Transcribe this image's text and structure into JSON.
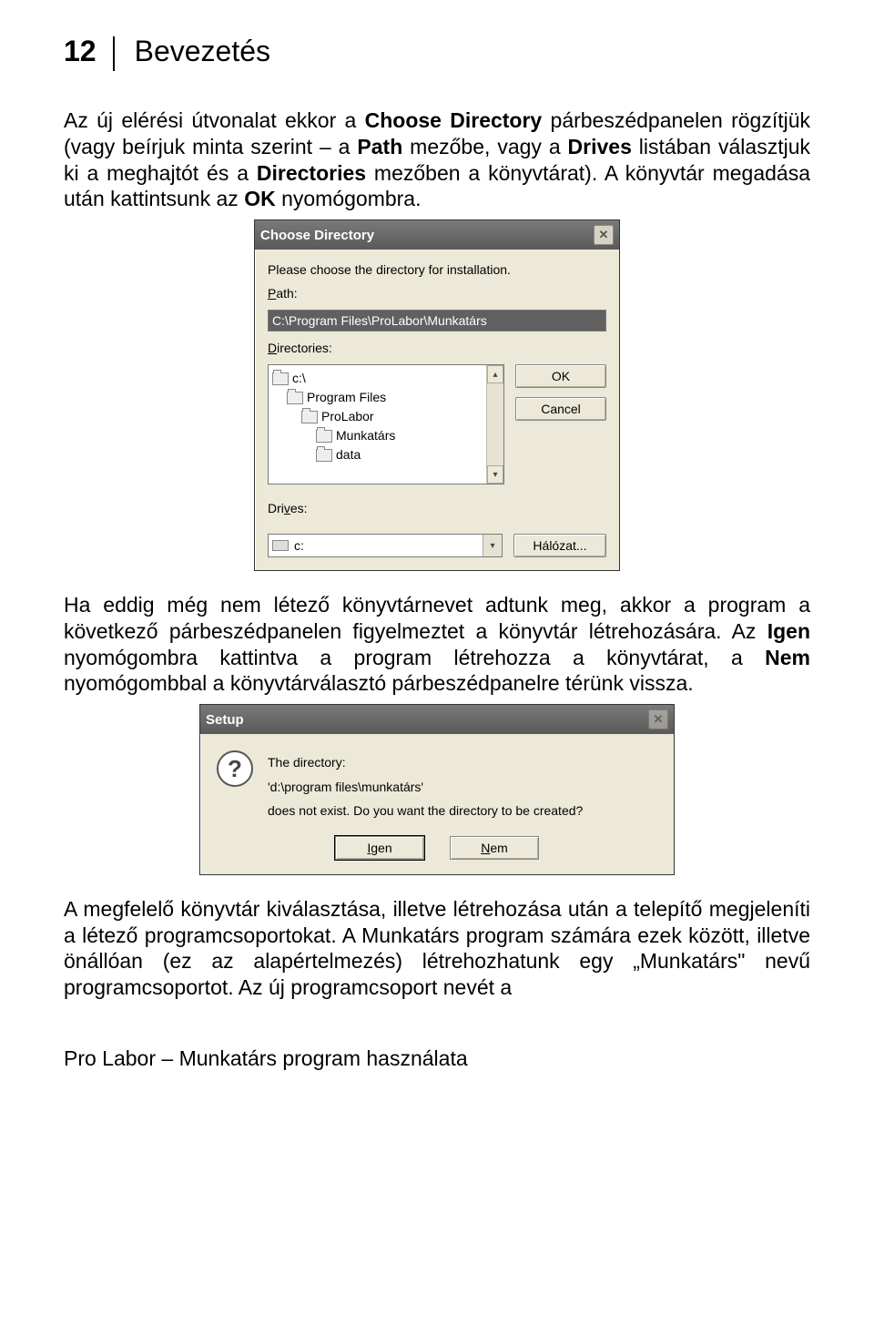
{
  "page_number": "12",
  "chapter_title": "Bevezetés",
  "para1": {
    "t1": "Az új elérési útvonalat ekkor a ",
    "b1": "Choose Directory",
    "t2": " párbeszédpanelen rögzítjük (vagy beírjuk minta szerint – a ",
    "b2": "Path",
    "t3": " mezőbe, vagy a ",
    "b3": "Drives",
    "t4": " listában választjuk ki a meghajtót és a ",
    "b4": "Directories",
    "t5": " mezőben a könyvtárat). A könyvtár megadása után kattintsunk az ",
    "b5": "OK",
    "t6": " nyomógombra."
  },
  "dlg1": {
    "title": "Choose Directory",
    "instr": "Please choose the directory for installation.",
    "path_label_pre": "P",
    "path_label_post": "ath:",
    "path_value": "C:\\Program Files\\ProLabor\\Munkatárs",
    "dirs_label_pre": "D",
    "dirs_label_post": "irectories:",
    "dirs": [
      "c:\\",
      "Program Files",
      "ProLabor",
      "Munkatárs",
      "data"
    ],
    "ok": "OK",
    "cancel": "Cancel",
    "drives_label_pre": "Dri",
    "drives_label_mid": "v",
    "drives_label_post": "es:",
    "drive_value": "c:",
    "network": "Hálózat..."
  },
  "para2": {
    "t1": "Ha eddig még nem létező könyvtárnevet adtunk meg, akkor a program a következő párbeszédpanelen figyelmeztet a könyvtár létrehozására. Az ",
    "b1": "Igen",
    "t2": " nyomógombra kattintva a program létrehozza a könyvtárat, a ",
    "b2": "Nem",
    "t3": " nyomógombbal a könyvtárválasztó párbeszédpanelre térünk vissza."
  },
  "dlg2": {
    "title": "Setup",
    "line1": "The directory:",
    "line2": "'d:\\program files\\munkatárs'",
    "line3": "does not exist.  Do you want the directory to be created?",
    "yes_pre": "I",
    "yes_post": "gen",
    "no_pre": "N",
    "no_post": "em"
  },
  "para3": "A megfelelő könyvtár kiválasztása, illetve létrehozása után a telepítő megjeleníti a létező programcsoportokat. A Munkatárs program számára ezek között, illetve önállóan (ez az alapértelmezés) létrehozhatunk egy „Munkatárs\" nevű programcsoportot. Az új  programcsoport nevét a",
  "footer": "Pro Labor – Munkatárs program használata"
}
